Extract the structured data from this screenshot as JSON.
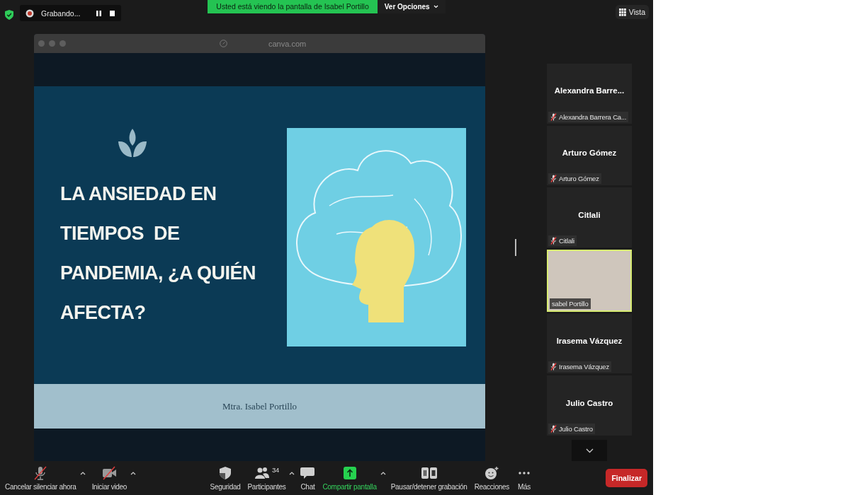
{
  "top_bar": {
    "recording": {
      "label": "Grabando..."
    },
    "banner": "Usted está viendo la pantalla de Isabel Portillo",
    "view_options": "Ver Opciones",
    "view": "Vista"
  },
  "shared_window": {
    "url": "canva.com",
    "slide": {
      "title_lines": [
        "LA ANSIEDAD EN",
        "TIEMPOS  DE",
        "PANDEMIA, ¿A QUIÉN",
        "AFECTA?"
      ],
      "presenter": "Mtra. Isabel Portillo"
    }
  },
  "participants": [
    {
      "kind": "avatar",
      "name": "Alexandra  Barre...",
      "label": "Alexandra Barrera Ca...",
      "muted": true,
      "speaking": false
    },
    {
      "kind": "avatar",
      "name": "Arturo Gómez",
      "label": "Arturo Gómez",
      "muted": true,
      "speaking": false
    },
    {
      "kind": "avatar",
      "name": "Citlali",
      "label": "Citlali",
      "muted": true,
      "speaking": false
    },
    {
      "kind": "video",
      "label": "sabel Portillo",
      "muted": false,
      "speaking": true
    },
    {
      "kind": "avatar",
      "name": "Irasema Vázquez",
      "label": "Irasema Vázquez",
      "muted": true,
      "speaking": false
    },
    {
      "kind": "avatar",
      "name": "Julio Castro",
      "label": "Julio Castro",
      "muted": true,
      "speaking": false
    }
  ],
  "toolbar": {
    "left": [
      {
        "kind": "mic",
        "label": "Cancelar silenciar ahora",
        "off": true,
        "has_menu": true,
        "active": false
      },
      {
        "kind": "video",
        "label": "Iniciar video",
        "off": true,
        "has_menu": true,
        "active": false
      }
    ],
    "center": [
      {
        "kind": "security",
        "label": "Seguridad",
        "off": false,
        "has_menu": false,
        "active": false
      },
      {
        "kind": "participants",
        "label": "Participantes",
        "count": "34",
        "off": false,
        "has_menu": true,
        "active": false
      },
      {
        "kind": "chat",
        "label": "Chat",
        "off": false,
        "has_menu": false,
        "active": false
      },
      {
        "kind": "share",
        "label": "Compartir pantalla",
        "off": false,
        "has_menu": true,
        "active": true
      },
      {
        "kind": "record",
        "label": "Pausar/detener grabación",
        "off": false,
        "has_menu": false,
        "active": false
      },
      {
        "kind": "reactions",
        "label": "Reacciones",
        "off": false,
        "has_menu": false,
        "active": false
      },
      {
        "kind": "more",
        "label": "Más",
        "off": false,
        "has_menu": false,
        "active": false
      }
    ],
    "end_button": "Finalizar"
  }
}
